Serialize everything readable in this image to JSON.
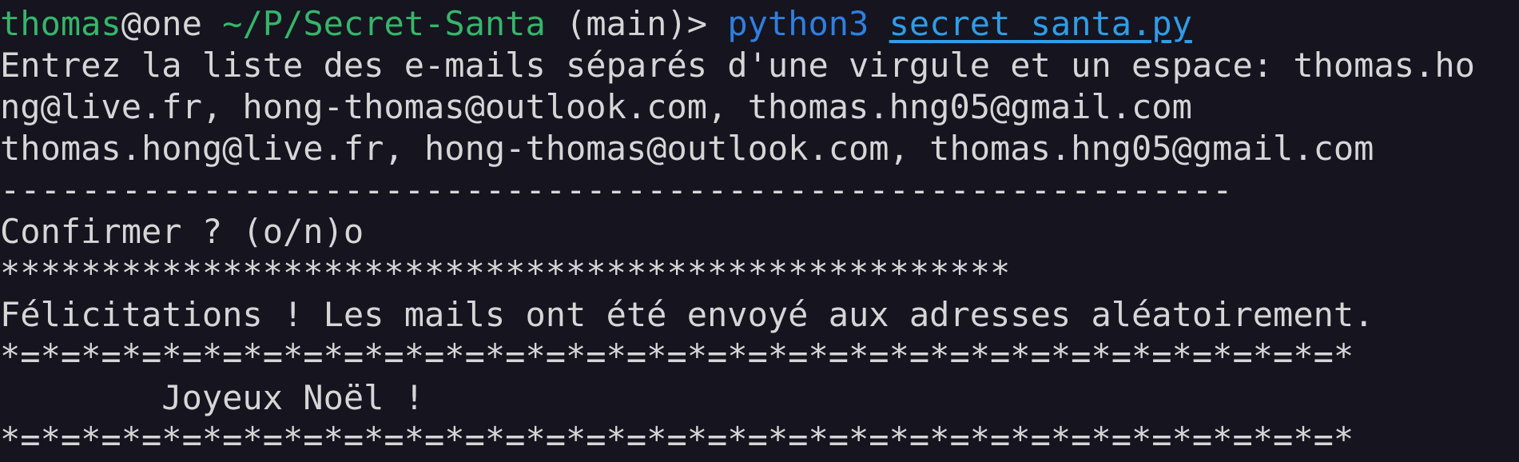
{
  "terminal": {
    "prompt": {
      "user": "thomas",
      "at": "@",
      "host": "one",
      "space": " ",
      "path": "~/P/Secret-Santa",
      "branch": " (main)> ",
      "command": "python3",
      "arg": "secret_santa.py"
    },
    "lines": {
      "input_prompt": "Entrez la liste des e-mails séparés d'une virgule et un espace: thomas.ho",
      "input_wrap": "ng@live.fr, hong-thomas@outlook.com, thomas.hng05@gmail.com",
      "echo": "thomas.hong@live.fr, hong-thomas@outlook.com, thomas.hng05@gmail.com",
      "dashes": "-------------------------------------------------------------",
      "confirm": "Confirmer ? (o/n)o",
      "stars": "**************************************************",
      "success": "Félicitations ! Les mails ont été envoyé aux adresses aléatoirement.",
      "banner_top": "*=*=*=*=*=*=*=*=*=*=*=*=*=*=*=*=*=*=*=*=*=*=*=*=*=*=*=*=*=*=*=*=*=*",
      "greeting": "        Joyeux Noël !",
      "banner_bottom": "*=*=*=*=*=*=*=*=*=*=*=*=*=*=*=*=*=*=*=*=*=*=*=*=*=*=*=*=*=*=*=*=*=*"
    }
  }
}
